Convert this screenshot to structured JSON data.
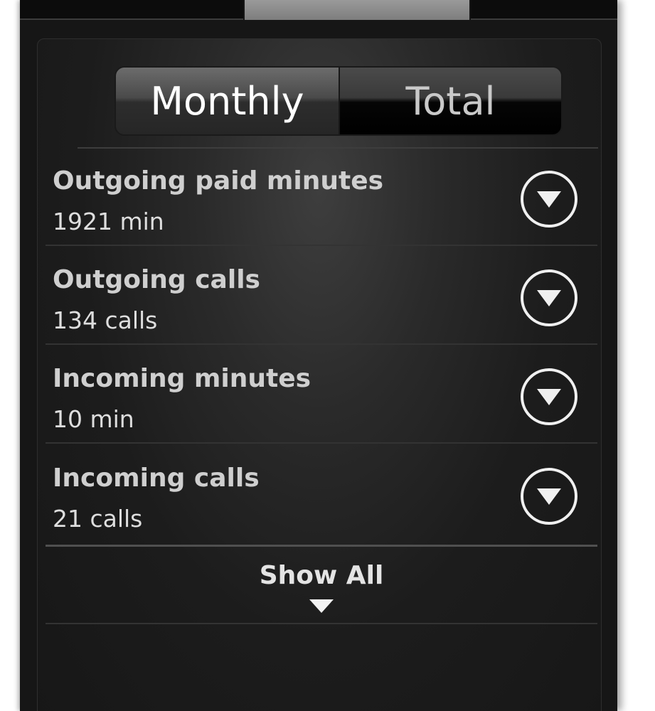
{
  "toggle": {
    "monthly_label": "Monthly",
    "total_label": "Total",
    "selected": "Monthly"
  },
  "stats": [
    {
      "title": "Outgoing paid minutes",
      "value": "1921 min"
    },
    {
      "title": "Outgoing calls",
      "value": "134 calls"
    },
    {
      "title": "Incoming minutes",
      "value": "10 min"
    },
    {
      "title": "Incoming calls",
      "value": "21 calls"
    }
  ],
  "show_all": {
    "label": "Show All"
  },
  "icons": {
    "expand": "chevron-down-circle-icon",
    "show_all": "triangle-down-icon"
  },
  "colors": {
    "background": "#161616",
    "text_primary": "#cfcfcf",
    "text_active": "#ffffff",
    "icon": "#f0f0f0"
  }
}
